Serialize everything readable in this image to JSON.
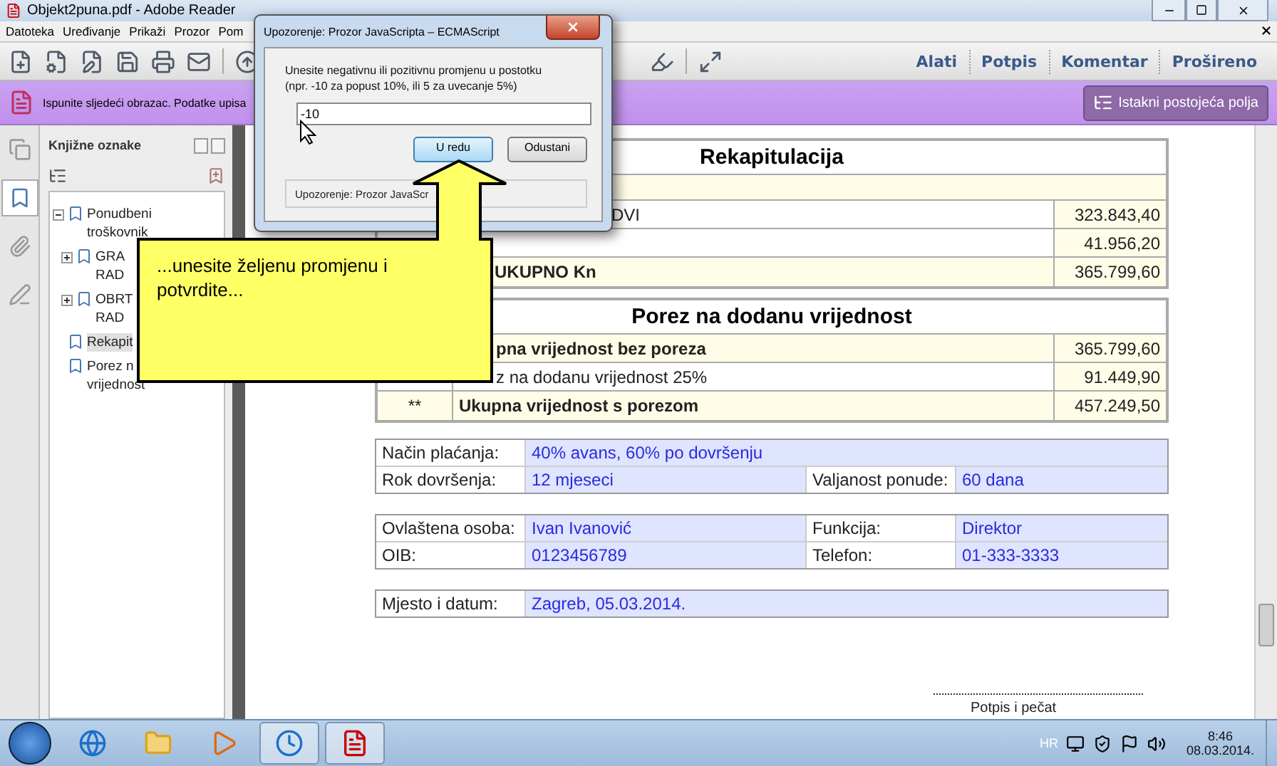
{
  "window": {
    "title": "Objekt2puna.pdf - Adobe Reader"
  },
  "menu": [
    "Datoteka",
    "Uređivanje",
    "Prikaži",
    "Prozor",
    "Pom"
  ],
  "toolbar_tabs": [
    "Alati",
    "Potpis",
    "Komentar",
    "Prošireno"
  ],
  "form_bar": {
    "message": "Ispunite sljedeći obrazac. Podatke upisa",
    "button": "Istakni postojeća polja"
  },
  "sidebar": {
    "title": "Knjižne oznake",
    "tabs": [
      {
        "kind": "pages",
        "selected": false
      },
      {
        "kind": "bookmarks",
        "selected": true
      },
      {
        "kind": "attachments",
        "selected": false
      },
      {
        "kind": "signatures",
        "selected": false
      }
    ],
    "bookmarks": [
      {
        "lines": [
          "Ponudbeni",
          "troškovnik"
        ],
        "expanded": true,
        "selected": false,
        "children": [
          {
            "lines": [
              "GRA",
              "RAD"
            ],
            "expanded": false,
            "selected": false
          },
          {
            "lines": [
              "OBRT",
              "RAD"
            ],
            "expanded": false,
            "selected": false
          }
        ]
      },
      {
        "lines": [
          "Rekapit"
        ],
        "selected": true
      },
      {
        "lines": [
          "Porez n",
          "vrijednost"
        ],
        "selected": false
      }
    ]
  },
  "recap": {
    "title": "Rekapitulacija",
    "rows": [
      {
        "label": "DVI",
        "value": "323.843,40",
        "bold": false
      },
      {
        "value": "41.956,20",
        "bold": false
      },
      {
        "label": "UKUPNO Kn",
        "value": "365.799,60",
        "bold": true
      }
    ]
  },
  "vat": {
    "title": "Porez na dodanu vrijednost",
    "rows": [
      {
        "label": "pna vrijednost bez poreza",
        "value": "365.799,60",
        "bold": true
      },
      {
        "label": "z na dodanu vrijednost 25%",
        "value": "91.449,90",
        "bold": false
      },
      {
        "mark": "**",
        "label": "Ukupna vrijednost s porezom",
        "value": "457.249,50",
        "bold": true
      }
    ]
  },
  "info_tables": [
    [
      [
        {
          "label": "Način plaćanja:",
          "value": "40% avans, 60% po dovršenju"
        }
      ],
      [
        {
          "label": "Rok dovršenja:",
          "value": "12 mjeseci"
        },
        {
          "label": "Valjanost ponude:",
          "value": "60 dana"
        }
      ]
    ],
    [
      [
        {
          "label": "Ovlaštena osoba:",
          "value": "Ivan Ivanović"
        },
        {
          "label": "Funkcija:",
          "value": "Direktor"
        }
      ],
      [
        {
          "label": "OIB:",
          "value": "0123456789"
        },
        {
          "label": "Telefon:",
          "value": "01-333-3333"
        }
      ]
    ],
    [
      [
        {
          "label": "Mjesto i datum:",
          "value": "Zagreb, 05.03.2014."
        }
      ]
    ]
  ],
  "signature": "Potpis i pečat",
  "dialog": {
    "title": "Upozorenje: Prozor JavaScripta – ECMAScript",
    "message": [
      "Unesite negativnu ili pozitivnu promjenu u postotku",
      "(npr. -10 za popust 10%, ili 5 za uvecanje 5%)"
    ],
    "value": "-10",
    "buttons": [
      {
        "label": "U redu",
        "default": true
      },
      {
        "label": "Odustani",
        "default": false
      }
    ],
    "status": "Upozorenje: Prozor JavaScr"
  },
  "callout": {
    "text": "...unesite željenu promjenu i potvrdite..."
  },
  "taskbar": {
    "apps": [
      {
        "kind": "browser",
        "active": false
      },
      {
        "kind": "folder",
        "active": false
      },
      {
        "kind": "media",
        "active": false
      },
      {
        "kind": "clock",
        "active": true
      },
      {
        "kind": "pdf",
        "active": true
      }
    ],
    "language": "HR",
    "time": "8:46",
    "date": "08.03.2014."
  }
}
